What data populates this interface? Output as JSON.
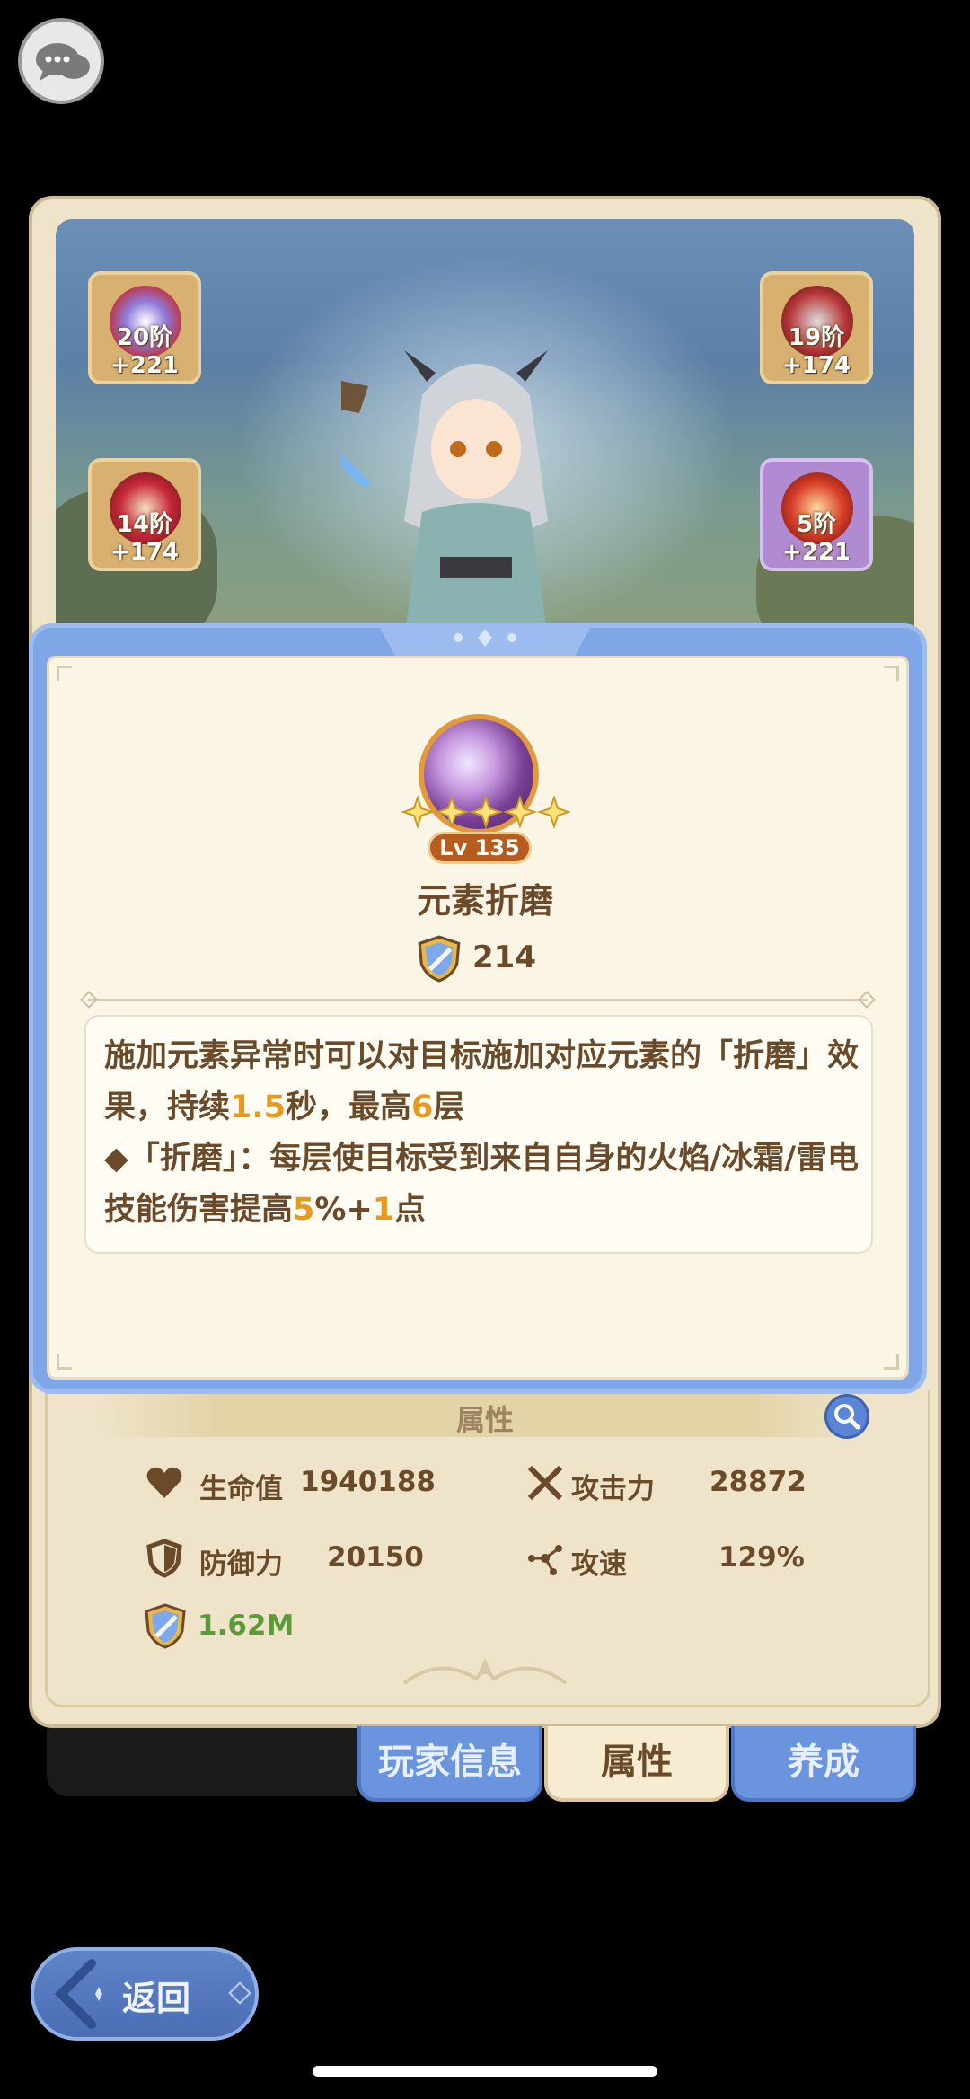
{
  "equipment": [
    {
      "name": "helmet",
      "level": "20阶+221",
      "rarity": "gold"
    },
    {
      "name": "crest",
      "level": "19阶+174",
      "rarity": "gold"
    },
    {
      "name": "armor",
      "level": "14阶+174",
      "rarity": "gold"
    },
    {
      "name": "gauntlet",
      "level": "5阶+221",
      "rarity": "purple"
    }
  ],
  "skill": {
    "level_badge": "Lv 135",
    "stars": 5,
    "name": "元素折磨",
    "power": "214",
    "desc_parts": [
      {
        "text": "施加元素异常时可以对目标施加对应元素的「折磨」效果，持续",
        "hl": false
      },
      {
        "text": "1.5",
        "hl": true
      },
      {
        "text": "秒，最高",
        "hl": false
      },
      {
        "text": "6",
        "hl": true
      },
      {
        "text": "层",
        "hl": false
      },
      {
        "text": "\n◆「折磨」：每层使目标受到来自自身的火焰/冰霜/雷电技能伤害提高",
        "hl": false
      },
      {
        "text": "5",
        "hl": true
      },
      {
        "text": "%+",
        "hl": false
      },
      {
        "text": "1",
        "hl": true
      },
      {
        "text": "点",
        "hl": false
      }
    ]
  },
  "attributes": {
    "title": "属性",
    "hp_label": "生命值",
    "hp_value": "1940188",
    "atk_label": "攻击力",
    "atk_value": "28872",
    "def_label": "防御力",
    "def_value": "20150",
    "spd_label": "攻速",
    "spd_value": "129%",
    "power_total": "1.62M"
  },
  "tabs": [
    {
      "label": "玩家信息",
      "active": false
    },
    {
      "label": "属性",
      "active": true
    },
    {
      "label": "养成",
      "active": false
    }
  ],
  "back_label": "返回",
  "colors": {
    "accent_blue": "#6b94df",
    "highlight_orange": "#e89a1c",
    "text_brown": "#6b4a2a",
    "power_green": "#5b9a3a"
  }
}
